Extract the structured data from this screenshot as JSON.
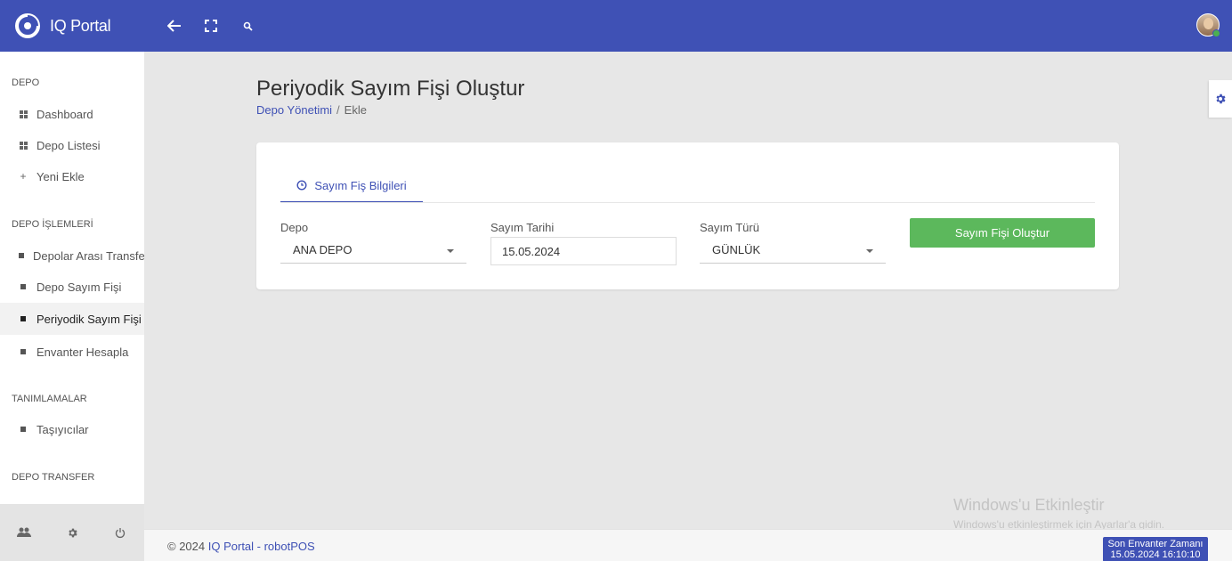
{
  "app": {
    "name": "IQ Portal"
  },
  "colors": {
    "primary": "#3f51b5",
    "success": "#5cb85c",
    "online": "#4caf50"
  },
  "topbar": {
    "icons": [
      "back-arrow-icon",
      "fullscreen-icon",
      "search-icon"
    ],
    "avatar": "user-avatar"
  },
  "sidebar": {
    "sections": [
      {
        "title": "DEPO",
        "items": [
          {
            "label": "Dashboard",
            "icon": "dashboard-icon"
          },
          {
            "label": "Depo Listesi",
            "icon": "list-icon"
          },
          {
            "label": "Yeni Ekle",
            "icon": "plus-icon"
          }
        ]
      },
      {
        "title": "DEPO İŞLEMLERİ",
        "items": [
          {
            "label": "Depolar Arası Transfer",
            "icon": "square-icon"
          },
          {
            "label": "Depo Sayım Fişi",
            "icon": "square-icon"
          },
          {
            "label": "Periyodik Sayım Fişi",
            "icon": "square-icon",
            "active": true
          },
          {
            "label": "Envanter Hesapla",
            "icon": "square-icon"
          }
        ]
      },
      {
        "title": "TANIMLAMALAR",
        "items": [
          {
            "label": "Taşıyıcılar",
            "icon": "square-icon"
          }
        ]
      },
      {
        "title": "DEPO TRANSFER",
        "items": []
      }
    ],
    "footer_icons": [
      "users-icon",
      "gear-icon",
      "power-icon"
    ]
  },
  "page": {
    "title": "Periyodik Sayım Fişi Oluştur",
    "breadcrumb": {
      "link": "Depo Yönetimi",
      "current": "Ekle"
    }
  },
  "card": {
    "tab_label": "Sayım Fiş Bilgileri",
    "fields": {
      "depo": {
        "label": "Depo",
        "value": "ANA DEPO"
      },
      "tarih": {
        "label": "Sayım Tarihi",
        "value": "15.05.2024"
      },
      "tur": {
        "label": "Sayım Türü",
        "value": "GÜNLÜK"
      }
    },
    "submit_label": "Sayım Fişi Oluştur"
  },
  "watermark": {
    "title": "Windows'u Etkinleştir",
    "subtitle": "Windows'u etkinleştirmek için Ayarlar'a gidin."
  },
  "footer": {
    "copyright": "© 2024",
    "link": "IQ Portal - robotPOS",
    "badge_line1": "Son Envanter Zamanı",
    "badge_line2": "15.05.2024 16:10:10"
  }
}
